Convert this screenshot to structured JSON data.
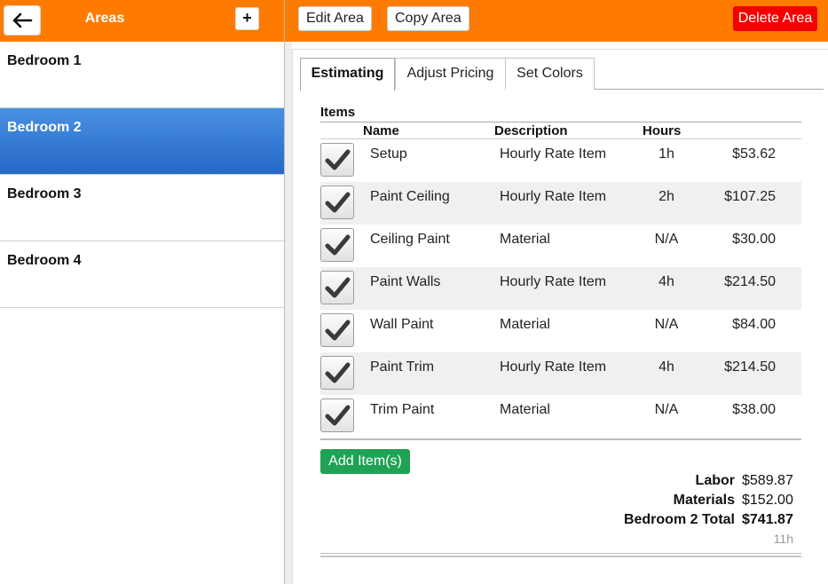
{
  "sidebar": {
    "back_icon": "arrow-left-icon",
    "title": "Areas",
    "add_label": "+",
    "areas": [
      {
        "label": "Bedroom 1"
      },
      {
        "label": "Bedroom 2"
      },
      {
        "label": "Bedroom 3"
      },
      {
        "label": "Bedroom 4"
      }
    ],
    "selected_index": 1
  },
  "toolbar": {
    "edit_label": "Edit Area",
    "copy_label": "Copy Area",
    "delete_label": "Delete Area"
  },
  "tabs": [
    {
      "label": "Estimating",
      "active": true
    },
    {
      "label": "Adjust Pricing",
      "active": false
    },
    {
      "label": "Set Colors",
      "active": false
    }
  ],
  "items": {
    "heading": "Items",
    "columns": {
      "name": "Name",
      "description": "Description",
      "hours": "Hours"
    },
    "rows": [
      {
        "checked": true,
        "name": "Setup",
        "description": "Hourly Rate Item",
        "hours": "1h",
        "price": "$53.62"
      },
      {
        "checked": true,
        "name": "Paint Ceiling",
        "description": "Hourly Rate Item",
        "hours": "2h",
        "price": "$107.25"
      },
      {
        "checked": true,
        "name": "Ceiling Paint",
        "description": "Material",
        "hours": "N/A",
        "price": "$30.00"
      },
      {
        "checked": true,
        "name": "Paint Walls",
        "description": "Hourly Rate Item",
        "hours": "4h",
        "price": "$214.50"
      },
      {
        "checked": true,
        "name": "Wall Paint",
        "description": "Material",
        "hours": "N/A",
        "price": "$84.00"
      },
      {
        "checked": true,
        "name": "Paint Trim",
        "description": "Hourly Rate Item",
        "hours": "4h",
        "price": "$214.50"
      },
      {
        "checked": true,
        "name": "Trim Paint",
        "description": "Material",
        "hours": "N/A",
        "price": "$38.00"
      }
    ],
    "add_label": "Add Item(s)"
  },
  "totals": {
    "labor_label": "Labor",
    "labor_value": "$589.87",
    "materials_label": "Materials",
    "materials_value": "$152.00",
    "total_label": "Bedroom 2 Total",
    "total_value": "$741.87",
    "hours": "11h"
  },
  "colors": {
    "header_orange": "#ff7b00",
    "selected_blue": "#2f76d2",
    "delete_red": "#f40000",
    "add_green": "#1fa254"
  }
}
